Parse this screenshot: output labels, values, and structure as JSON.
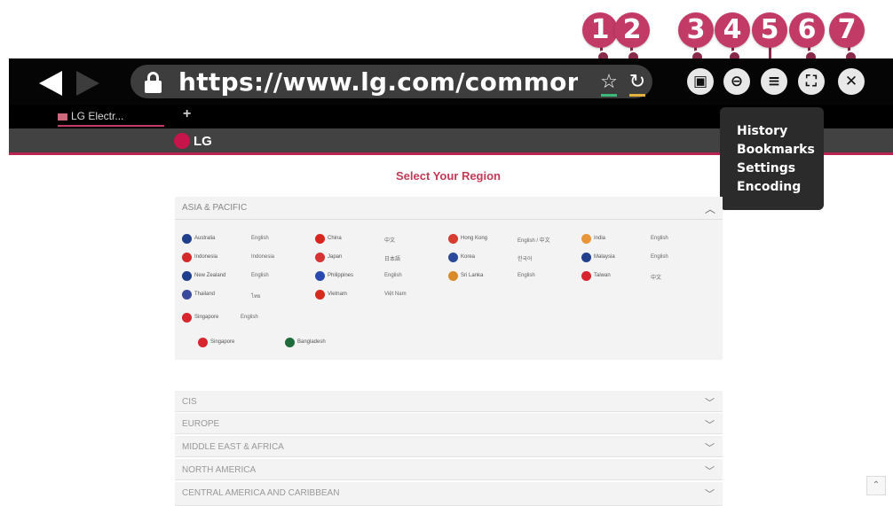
{
  "callouts": [
    "1",
    "2",
    "3",
    "4",
    "5",
    "6",
    "7"
  ],
  "toolbar": {
    "url": "https://www.lg.com/common/i...",
    "buttons": {
      "bookmark_star_icon": "☆",
      "reload_icon": "↻",
      "mode_icon": "▣",
      "zoom_icon": "⊖",
      "menu_icon": "≡",
      "fullscreen_icon": "⛶",
      "close_icon": "✕"
    }
  },
  "tabs": [
    {
      "label": "LG Electr..."
    }
  ],
  "new_tab_label": "+",
  "site": {
    "logo_text": "LG"
  },
  "menu": [
    "History",
    "Bookmarks",
    "Settings",
    "Encoding"
  ],
  "page": {
    "title": "Select Your Region",
    "expanded_region": "ASIA & PACIFIC",
    "countries": [
      {
        "name": "Australia",
        "lang": "English",
        "color": "#1f3f8c"
      },
      {
        "name": "China",
        "lang": "中文",
        "color": "#d7261e"
      },
      {
        "name": "Hong Kong",
        "lang": "English / 中文",
        "color": "#d63c2f"
      },
      {
        "name": "India",
        "lang": "English",
        "color": "#e8953a"
      },
      {
        "name": "Indonesia",
        "lang": "Indonesia",
        "color": "#d62a2a"
      },
      {
        "name": "Japan",
        "lang": "日本語",
        "color": "#d63333"
      },
      {
        "name": "Korea",
        "lang": "한국어",
        "color": "#2c4a9a"
      },
      {
        "name": "Malaysia",
        "lang": "English",
        "color": "#23408d"
      },
      {
        "name": "New Zealand",
        "lang": "English",
        "color": "#1f3f8c"
      },
      {
        "name": "Philippines",
        "lang": "English",
        "color": "#2a49b0"
      },
      {
        "name": "Sri Lanka",
        "lang": "English",
        "color": "#d98a2a"
      },
      {
        "name": "Taiwan",
        "lang": "中文",
        "color": "#d8262f"
      },
      {
        "name": "Thailand",
        "lang": "ไทย",
        "color": "#3a4a9a"
      },
      {
        "name": "Vietnam",
        "lang": "Việt Nam",
        "color": "#d62a1e"
      },
      {
        "name": "Singapore",
        "lang": "English",
        "color": "#d8262f"
      },
      {
        "name": "Singapore",
        "lang": "",
        "color": "#d8262f"
      },
      {
        "name": "Bangladesh",
        "lang": "",
        "color": "#1e6b3b"
      }
    ],
    "collapsed_regions": [
      "CIS",
      "EUROPE",
      "MIDDLE EAST & AFRICA",
      "NORTH AMERICA",
      "CENTRAL AMERICA AND CARIBBEAN"
    ]
  },
  "scroll_top_icon": "⌃"
}
